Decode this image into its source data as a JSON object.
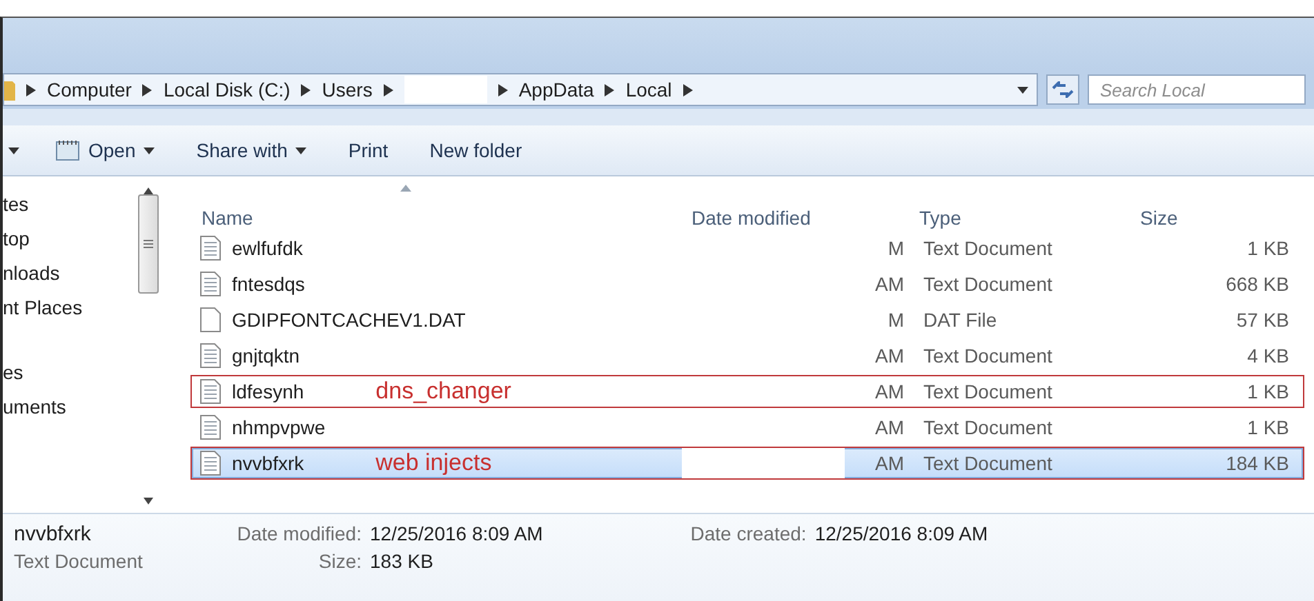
{
  "address_bar": {
    "crumbs": [
      {
        "kind": "text",
        "label": "Computer"
      },
      {
        "kind": "text",
        "label": "Local Disk (C:)"
      },
      {
        "kind": "text",
        "label": "Users"
      },
      {
        "kind": "redacted"
      },
      {
        "kind": "text",
        "label": "AppData"
      },
      {
        "kind": "text",
        "label": "Local"
      }
    ]
  },
  "search": {
    "placeholder": "Search Local"
  },
  "toolbar": [
    {
      "label": "Open",
      "has_icon": true,
      "dropdown": true
    },
    {
      "label": "Share with",
      "has_icon": false,
      "dropdown": true
    },
    {
      "label": "Print",
      "has_icon": false,
      "dropdown": false
    },
    {
      "label": "New folder",
      "has_icon": false,
      "dropdown": false
    }
  ],
  "sidebar": {
    "groups": [
      [
        "tes",
        "top",
        "nloads",
        "nt Places"
      ],
      [
        "es",
        "uments"
      ]
    ]
  },
  "table": {
    "columns": [
      "Name",
      "Date modified",
      "Type",
      "Size"
    ],
    "rows": [
      {
        "name": "ewlfufdk",
        "kind": "text",
        "date": "M",
        "type": "Text Document",
        "size": "1 KB",
        "selected": false
      },
      {
        "name": "fntesdqs",
        "kind": "text",
        "date": "AM",
        "type": "Text Document",
        "size": "668 KB",
        "selected": false
      },
      {
        "name": "GDIPFONTCACHEV1.DAT",
        "kind": "blank",
        "date": "M",
        "type": "DAT File",
        "size": "57 KB",
        "selected": false
      },
      {
        "name": "gnjtqktn",
        "kind": "text",
        "date": "AM",
        "type": "Text Document",
        "size": "4 KB",
        "selected": false
      },
      {
        "name": "ldfesynh",
        "kind": "text",
        "date": "AM",
        "type": "Text Document",
        "size": "1 KB",
        "selected": false,
        "annotation": "dns_changer"
      },
      {
        "name": "nhmpvpwe",
        "kind": "text",
        "date": "AM",
        "type": "Text Document",
        "size": "1 KB",
        "selected": false
      },
      {
        "name": "nvvbfxrk",
        "kind": "text",
        "date": "AM",
        "type": "Text Document",
        "size": "184 KB",
        "selected": true,
        "annotation": "web injects"
      }
    ]
  },
  "details": {
    "name": "nvvbfxrk",
    "type": "Text Document",
    "fields": [
      {
        "label": "Date modified:",
        "value": "12/25/2016 8:09 AM"
      },
      {
        "label": "Size:",
        "value": "183 KB"
      },
      {
        "label": "Date created:",
        "value": "12/25/2016 8:09 AM"
      }
    ]
  }
}
